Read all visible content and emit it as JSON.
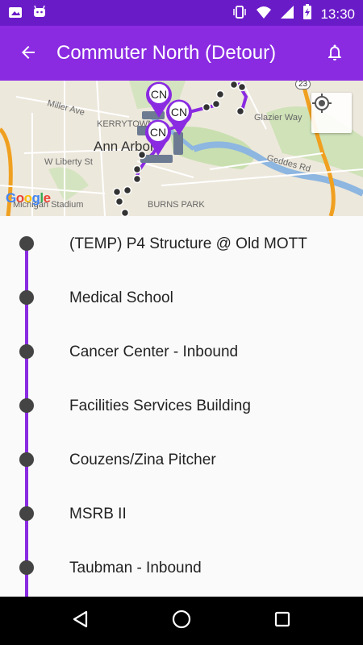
{
  "status_bar": {
    "time": "13:30",
    "icons": [
      "photo-notification-icon",
      "android-notification-icon",
      "vibrate-icon",
      "wifi-icon",
      "signal-icon",
      "battery-charging-icon"
    ]
  },
  "app_bar": {
    "title": "Commuter North (Detour)",
    "back_icon": "arrow-back-icon",
    "bell_icon": "notification-bell-icon"
  },
  "map": {
    "labels": {
      "miller": "Miller Ave",
      "kerrytown": "KERRYTOWN",
      "ann_arbor": "Ann Arbor",
      "liberty": "W Liberty St",
      "glazier": "Glazier Way",
      "geddes": "Geddes Rd",
      "burns": "BURNS PARK",
      "stadium": "Michigan Stadium",
      "hwy": "23"
    },
    "google": "Google",
    "marker_label": "CN",
    "locate_icon": "my-location-icon"
  },
  "stops": [
    {
      "name": "(TEMP) P4 Structure @ Old MOTT"
    },
    {
      "name": "Medical School"
    },
    {
      "name": "Cancer Center - Inbound"
    },
    {
      "name": "Facilities Services Building"
    },
    {
      "name": "Couzens/Zina Pitcher"
    },
    {
      "name": "MSRB II"
    },
    {
      "name": "Taubman - Inbound"
    }
  ],
  "nav_bar": {
    "icons": [
      "back-triangle-icon",
      "home-circle-icon",
      "recents-square-icon"
    ]
  },
  "colors": {
    "primary": "#8a2be2",
    "status": "#6a1bc8",
    "route": "#8a2be2"
  }
}
